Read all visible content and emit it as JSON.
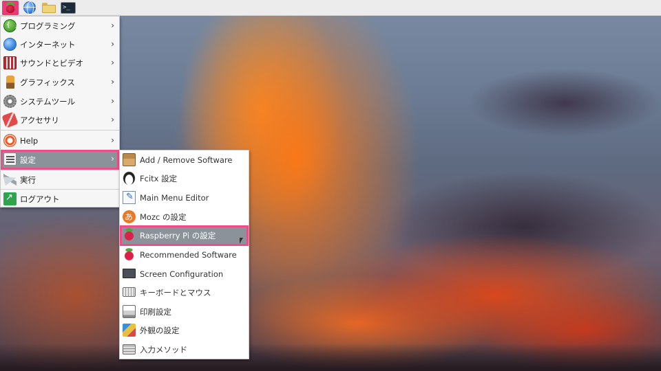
{
  "panel": {
    "buttons": [
      {
        "name": "menu-button",
        "icon": "raspberry-icon"
      },
      {
        "name": "browser-button",
        "icon": "globe-icon"
      },
      {
        "name": "file-manager-button",
        "icon": "folder-icon"
      },
      {
        "name": "terminal-button",
        "icon": "terminal-icon",
        "label": ">_"
      }
    ]
  },
  "main_menu": {
    "items": [
      {
        "label": "プログラミング",
        "icon": "programming-icon",
        "has_submenu": true
      },
      {
        "label": "インターネット",
        "icon": "internet-globe-icon",
        "has_submenu": true
      },
      {
        "label": "サウンドとビデオ",
        "icon": "sound-video-icon",
        "has_submenu": true
      },
      {
        "label": "グラフィックス",
        "icon": "graphics-brush-icon",
        "has_submenu": true
      },
      {
        "label": "システムツール",
        "icon": "system-gear-icon",
        "has_submenu": true
      },
      {
        "label": "アクセサリ",
        "icon": "accessories-icon",
        "has_submenu": true
      },
      {
        "label": "Help",
        "icon": "help-lifebuoy-icon",
        "has_submenu": true
      },
      {
        "label": "設定",
        "icon": "settings-icon",
        "has_submenu": true,
        "selected": true
      },
      {
        "label": "実行",
        "icon": "run-paper-plane-icon",
        "has_submenu": false
      },
      {
        "label": "ログアウト",
        "icon": "logout-icon",
        "has_submenu": false
      }
    ],
    "arrow_glyph": "›"
  },
  "settings_submenu": {
    "items": [
      {
        "label": "Add / Remove Software",
        "icon": "package-icon"
      },
      {
        "label": "Fcitx 設定",
        "icon": "tux-penguin-icon"
      },
      {
        "label": "Main Menu Editor",
        "icon": "menu-editor-icon"
      },
      {
        "label": "Mozc の設定",
        "icon": "mozc-icon"
      },
      {
        "label": "Raspberry Pi の設定",
        "icon": "raspberry-icon",
        "selected": true
      },
      {
        "label": "Recommended Software",
        "icon": "raspberry-icon"
      },
      {
        "label": "Screen Configuration",
        "icon": "monitor-icon"
      },
      {
        "label": "キーボードとマウス",
        "icon": "keyboard-mouse-icon"
      },
      {
        "label": "印刷設定",
        "icon": "printer-icon"
      },
      {
        "label": "外観の設定",
        "icon": "appearance-icon"
      },
      {
        "label": "入力メソッド",
        "icon": "input-method-keyboard-icon"
      }
    ]
  },
  "colors": {
    "highlight_outline": "#ec4f88",
    "selected_bg": "#8b929a",
    "panel_bg": "#ececec"
  }
}
